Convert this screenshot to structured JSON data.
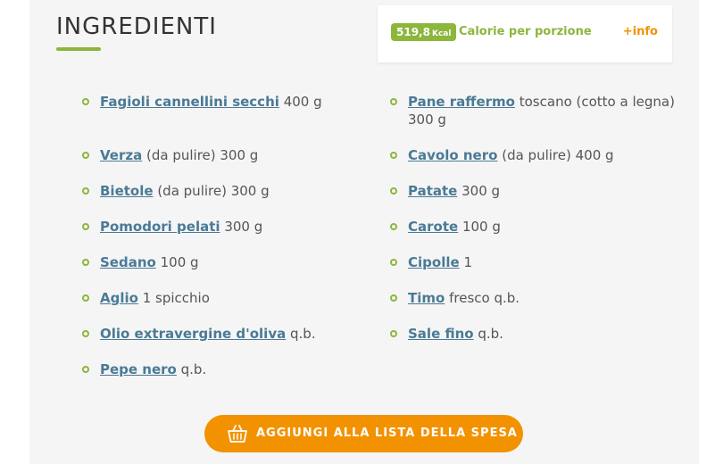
{
  "section": {
    "title": "INGREDIENTI"
  },
  "info": {
    "kcal_value": "519,8",
    "kcal_unit": "Kcal",
    "calorie_label": "Calorie per porzione",
    "more_info": "+info"
  },
  "ingredients_left": [
    {
      "name": "Fagioli cannellini secchi",
      "detail": "400 g"
    },
    {
      "name": "Verza",
      "detail": "(da pulire) 300 g"
    },
    {
      "name": "Bietole",
      "detail": "(da pulire) 300 g"
    },
    {
      "name": "Pomodori pelati",
      "detail": "300 g"
    },
    {
      "name": "Sedano",
      "detail": "100 g"
    },
    {
      "name": "Aglio",
      "detail": "1 spicchio"
    },
    {
      "name": "Olio extravergine d'oliva",
      "detail": "q.b."
    },
    {
      "name": "Pepe nero",
      "detail": "q.b."
    }
  ],
  "ingredients_right": [
    {
      "name": "Pane raffermo",
      "detail": "toscano (cotto a legna) 300 g"
    },
    {
      "name": "Cavolo nero",
      "detail": "(da pulire) 400 g"
    },
    {
      "name": "Patate",
      "detail": "300 g"
    },
    {
      "name": "Carote",
      "detail": "100 g"
    },
    {
      "name": "Cipolle",
      "detail": "1"
    },
    {
      "name": "Timo",
      "detail": "fresco q.b."
    },
    {
      "name": "Sale fino",
      "detail": "q.b."
    }
  ],
  "button": {
    "label": "AGGIUNGI ALLA LISTA DELLA SPESA",
    "icon": "shopping-basket-icon"
  },
  "colors": {
    "accent_green": "#8cb63c",
    "accent_orange": "#f39200",
    "link_blue": "#4a7a96"
  }
}
